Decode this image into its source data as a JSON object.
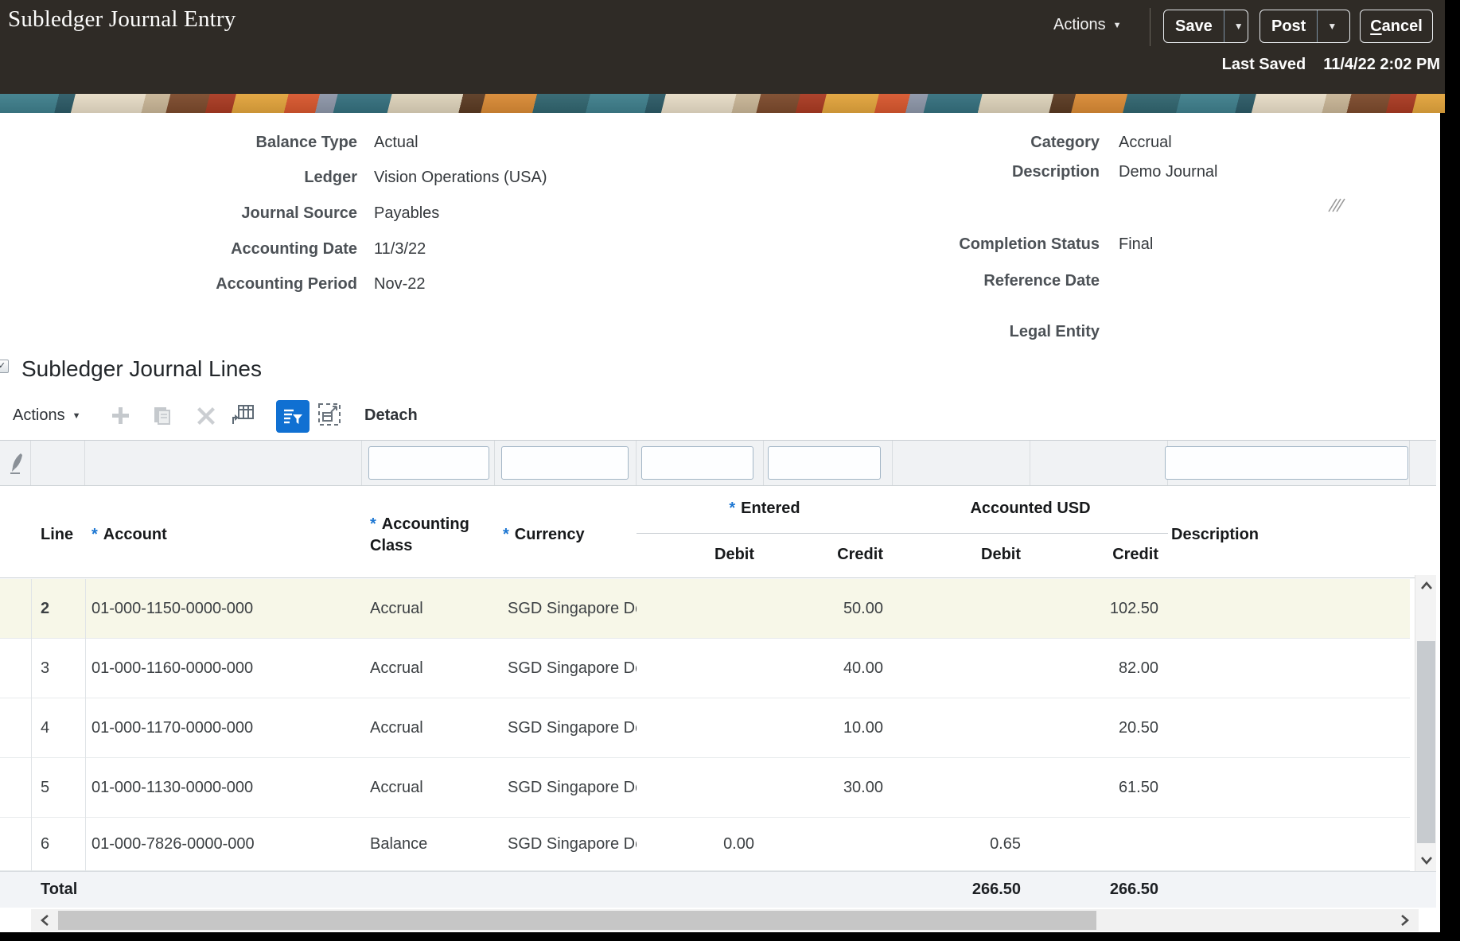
{
  "header": {
    "title": "Subledger Journal Entry",
    "actions_label": "Actions",
    "save_label": "Save",
    "post_label": "Post",
    "cancel_initial": "C",
    "cancel_rest": "ancel",
    "last_saved_label": "Last Saved",
    "last_saved_value": "11/4/22 2:02 PM"
  },
  "icons": {
    "caret_down": "▼",
    "disclosure_check": "✓"
  },
  "form": {
    "left": [
      {
        "label": "Balance Type",
        "value": "Actual"
      },
      {
        "label": "Ledger",
        "value": "Vision Operations (USA)"
      },
      {
        "label": "Journal Source",
        "value": "Payables"
      },
      {
        "label": "Accounting Date",
        "value": "11/3/22"
      },
      {
        "label": "Accounting Period",
        "value": "Nov-22"
      }
    ],
    "right": [
      {
        "label": "Category",
        "value": "Accrual"
      },
      {
        "label": "Description",
        "value": "Demo Journal"
      },
      {
        "label": "Completion Status",
        "value": "Final"
      },
      {
        "label": "Reference Date",
        "value": ""
      },
      {
        "label": "Legal Entity",
        "value": ""
      }
    ]
  },
  "lines": {
    "title": "Subledger Journal Lines",
    "toolbar": {
      "actions_label": "Actions",
      "detach_label": "Detach"
    },
    "table": {
      "required_marker": "*",
      "header": {
        "line": "Line",
        "account": "Account",
        "accounting_class": "Accounting Class",
        "currency": "Currency",
        "entered_group": "Entered",
        "accounted_group": "Accounted USD",
        "debit": "Debit",
        "credit": "Credit",
        "description": "Description"
      },
      "filters": {
        "accounting_class": "",
        "currency": "",
        "entered_debit": "",
        "entered_credit": "",
        "description": ""
      },
      "rows": [
        {
          "line": "2",
          "account": "01-000-1150-0000-000",
          "accounting_class": "Accrual",
          "currency": "SGD Singapore Do",
          "entered_debit": "",
          "entered_credit": "50.00",
          "accounted_debit": "",
          "accounted_credit": "102.50",
          "description": ""
        },
        {
          "line": "3",
          "account": "01-000-1160-0000-000",
          "accounting_class": "Accrual",
          "currency": "SGD Singapore Do",
          "entered_debit": "",
          "entered_credit": "40.00",
          "accounted_debit": "",
          "accounted_credit": "82.00",
          "description": ""
        },
        {
          "line": "4",
          "account": "01-000-1170-0000-000",
          "accounting_class": "Accrual",
          "currency": "SGD Singapore Do",
          "entered_debit": "",
          "entered_credit": "10.00",
          "accounted_debit": "",
          "accounted_credit": "20.50",
          "description": ""
        },
        {
          "line": "5",
          "account": "01-000-1130-0000-000",
          "accounting_class": "Accrual",
          "currency": "SGD Singapore Do",
          "entered_debit": "",
          "entered_credit": "30.00",
          "accounted_debit": "",
          "accounted_credit": "61.50",
          "description": ""
        },
        {
          "line": "6",
          "account": "01-000-7826-0000-000",
          "accounting_class": "Balance",
          "currency": "SGD Singapore Do",
          "entered_debit": "0.00",
          "entered_credit": "",
          "accounted_debit": "0.65",
          "accounted_credit": "",
          "description": ""
        }
      ],
      "total": {
        "label": "Total",
        "accounted_debit": "266.50",
        "accounted_credit": "266.50"
      }
    }
  },
  "colors": {
    "header_bg": "#2f2b26",
    "accent_blue": "#1070d2",
    "selected_row_bg": "#f7f7e8",
    "required_asterisk": "#1c76d2"
  }
}
